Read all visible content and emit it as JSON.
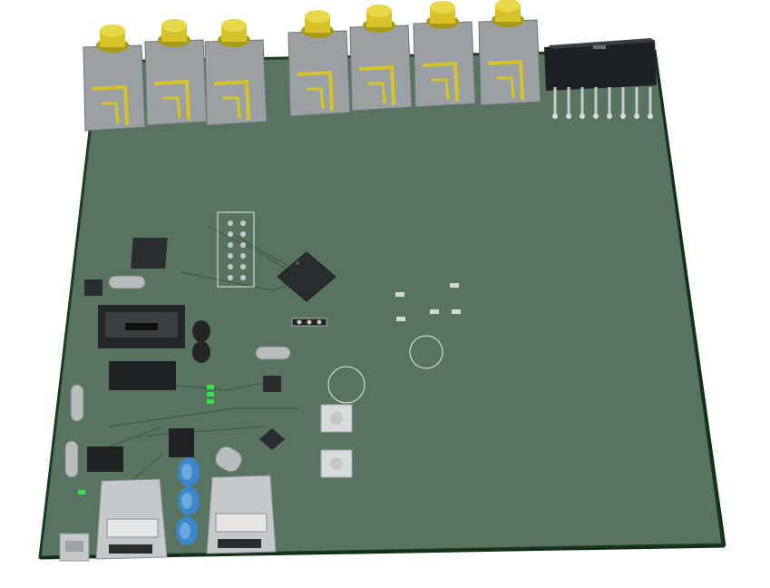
{
  "scene": {
    "kind": "3d-pcb-view",
    "background_color": "#ffffff",
    "board_color": "#587460",
    "board_edge_color": "#1d3a23",
    "silkscreen_color": "#e8ece6",
    "copper_color": "#c9a53a",
    "trace_color": "#3c5a45"
  },
  "components": {
    "rca_jacks": 7,
    "usb_ports": 2,
    "mini_usb": 1,
    "electrolytic_caps": 3,
    "crystals": 4,
    "tactile_buttons": 2,
    "colors": {
      "rca_body": "#9aa0a4",
      "rca_pin": "#d7c22a",
      "chip": "#2a2d30",
      "cap_blue": "#3d86c9",
      "led_green": "#38e05a",
      "usb_metal": "#c6c9cc"
    }
  }
}
